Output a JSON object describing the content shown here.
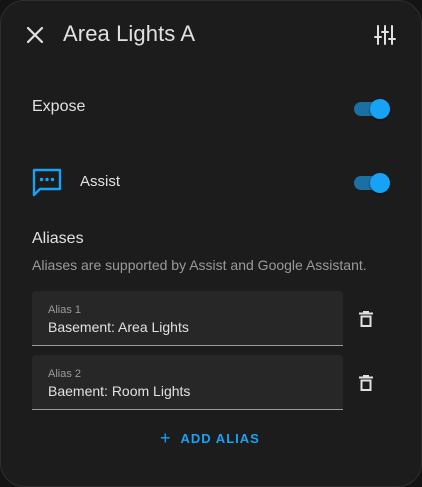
{
  "header": {
    "title": "Area Lights A",
    "close_icon": "close-icon",
    "settings_icon": "tune-icon"
  },
  "expose": {
    "label": "Expose",
    "enabled": true
  },
  "assist": {
    "label": "Assist",
    "icon": "message-text-icon",
    "enabled": true
  },
  "aliases": {
    "title": "Aliases",
    "description": "Aliases are supported by Assist and Google Assistant.",
    "items": [
      {
        "label": "Alias 1",
        "value": "Basement: Area Lights"
      },
      {
        "label": "Alias 2",
        "value": "Baement: Room Lights"
      }
    ],
    "add_label": "ADD ALIAS"
  },
  "colors": {
    "accent": "#16a3f6",
    "background": "#1c1c1c",
    "field": "#272727"
  }
}
